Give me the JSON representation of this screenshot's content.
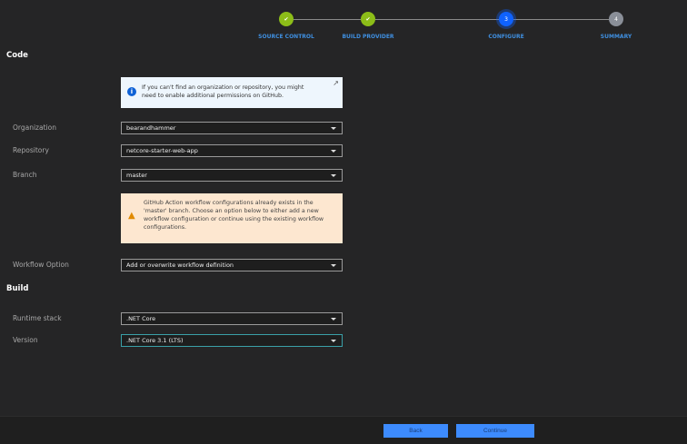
{
  "steps": [
    {
      "label": "SOURCE CONTROL",
      "state": "done",
      "icon": "check-icon"
    },
    {
      "label": "BUILD PROVIDER",
      "state": "done",
      "icon": "check-icon"
    },
    {
      "label": "CONFIGURE",
      "state": "active",
      "number": "3"
    },
    {
      "label": "SUMMARY",
      "state": "todo",
      "number": "4"
    }
  ],
  "code": {
    "heading": "Code",
    "info": "If you can't find an organization or repository, you might need to enable additional permissions on GitHub.",
    "organization": {
      "label": "Organization",
      "value": "bearandhammer"
    },
    "repository": {
      "label": "Repository",
      "value": "netcore-starter-web-app"
    },
    "branch": {
      "label": "Branch",
      "value": "master"
    },
    "warning": "GitHub Action workflow configurations already exists in the 'master' branch. Choose an option below to either add a new workflow configuration or continue using the existing workflow configurations.",
    "workflow": {
      "label": "Workflow Option",
      "value": "Add or overwrite workflow definition"
    }
  },
  "build": {
    "heading": "Build",
    "runtime": {
      "label": "Runtime stack",
      "value": ".NET Core"
    },
    "version": {
      "label": "Version",
      "value": ".NET Core 3.1 (LTS)"
    }
  },
  "footer": {
    "back": "Back",
    "continue": "Continue"
  },
  "colors": {
    "done": "#8cbd18",
    "active": "#0f62fe",
    "button": "#3d8bfd",
    "warning_bg": "#fde7d0",
    "info_bg": "#eef6fd"
  }
}
